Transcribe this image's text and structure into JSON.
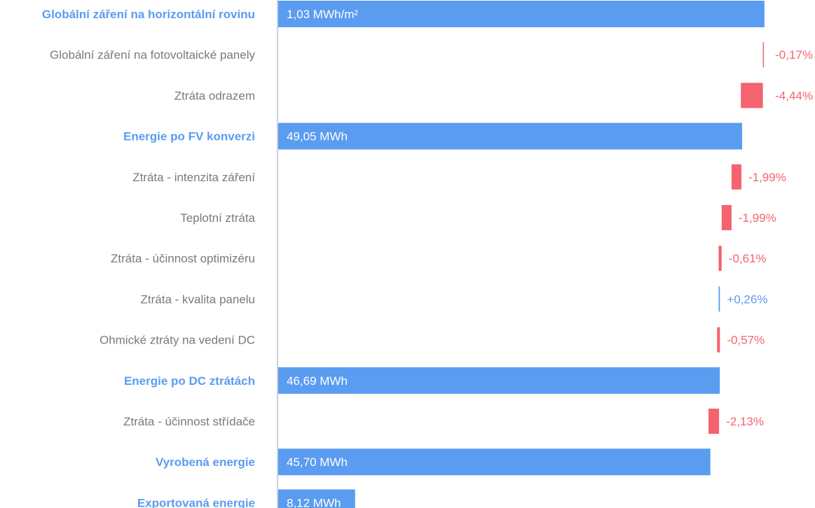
{
  "colors": {
    "total": "#5a9cf0",
    "loss": "#f4636f",
    "gain": "#5a9cf0",
    "label_muted": "#7a7a7a",
    "axis": "#b8bfd6"
  },
  "chart_data": {
    "type": "bar",
    "orientation": "horizontal",
    "subtype": "waterfall",
    "title": "",
    "xlabel": "",
    "ylabel": "",
    "grid": false,
    "legend": "none",
    "xlim": [
      0,
      1.0
    ],
    "categories": [
      "Globální záření na horizontální rovinu",
      "Globální záření na fotovoltaické panely",
      "Ztráta odrazem",
      "Energie po FV konverzi",
      "Ztráta - intenzita záření",
      "Teplotní ztráta",
      "Ztráta - účinnost optimizéru",
      "Ztráta - kvalita panelu",
      "Ohmické ztráty na vedení DC",
      "Energie po DC ztrátách",
      "Ztráta - účinnost střídače",
      "Vyrobená energie",
      "Exportovaná energie"
    ],
    "bars": [
      {
        "kind": "total",
        "relative": 0.98,
        "label": "1,03 MWh/m²"
      },
      {
        "kind": "loss",
        "relative": -0.0017,
        "label": "-0,17%"
      },
      {
        "kind": "loss",
        "relative": -0.0444,
        "label": "-4,44%"
      },
      {
        "kind": "total",
        "relative": 0.935,
        "label": "49,05 MWh"
      },
      {
        "kind": "loss",
        "relative": -0.0199,
        "label": "-1,99%"
      },
      {
        "kind": "loss",
        "relative": -0.0199,
        "label": "-1,99%"
      },
      {
        "kind": "loss",
        "relative": -0.0061,
        "label": "-0,61%"
      },
      {
        "kind": "gain",
        "relative": 0.0026,
        "label": "+0,26%"
      },
      {
        "kind": "loss",
        "relative": -0.0057,
        "label": "-0,57%"
      },
      {
        "kind": "total",
        "relative": 0.89,
        "label": "46,69 MWh"
      },
      {
        "kind": "loss",
        "relative": -0.0213,
        "label": "-2,13%"
      },
      {
        "kind": "total",
        "relative": 0.871,
        "label": "45,70 MWh"
      },
      {
        "kind": "total",
        "relative": 0.155,
        "label": "8,12 MWh"
      }
    ]
  }
}
